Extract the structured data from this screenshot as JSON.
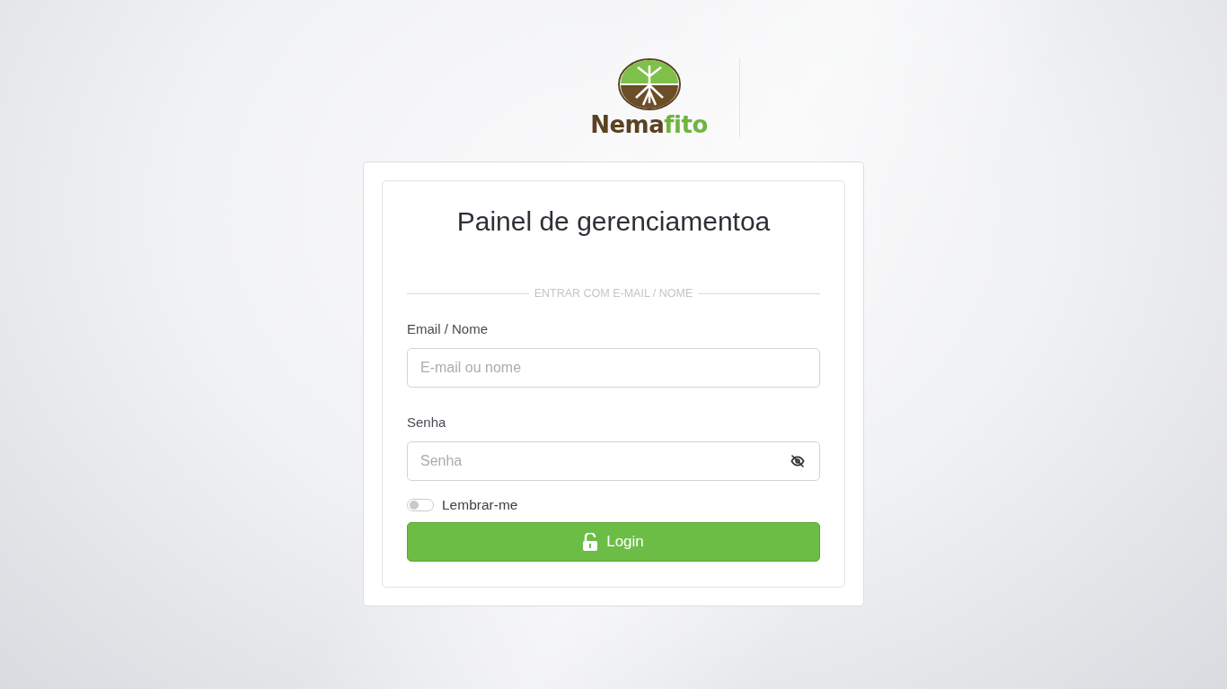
{
  "logo": {
    "name_dark": "Nema",
    "name_green": "fito"
  },
  "login": {
    "title": "Painel de gerenciamentoa",
    "divider": "ENTRAR COM E-MAIL / NOME",
    "fields": [
      {
        "label": "Email / Nome",
        "placeholder": "E-mail ou nome",
        "kind": "text"
      },
      {
        "label": "Senha",
        "placeholder": "Senha",
        "kind": "password"
      }
    ],
    "remember": {
      "label": "Lembrar-me",
      "on": false
    },
    "button": "Login"
  }
}
